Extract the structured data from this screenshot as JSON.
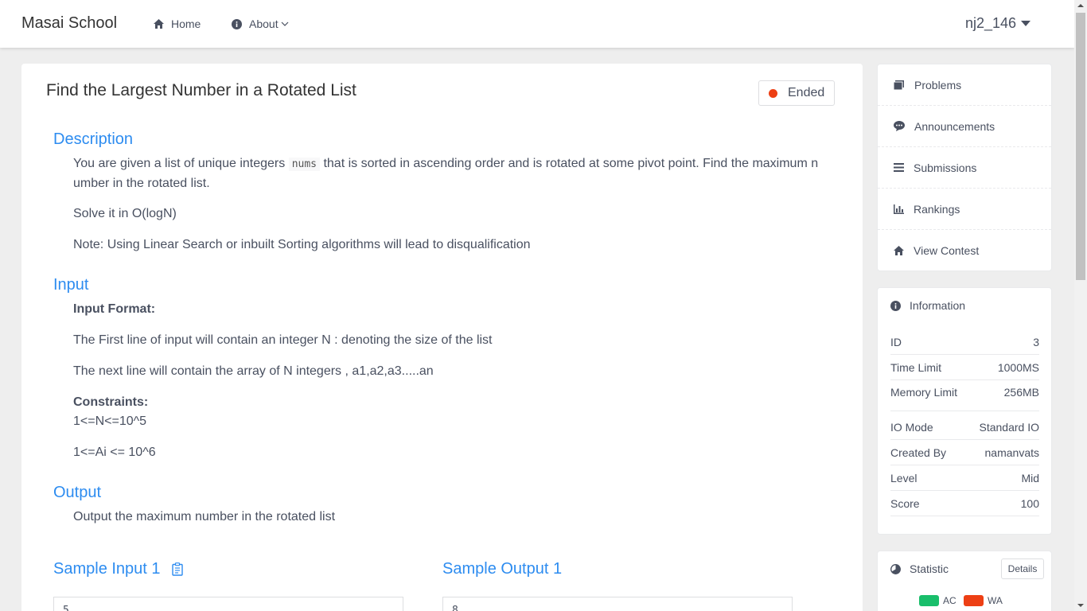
{
  "header": {
    "brand": "Masai School",
    "nav": {
      "home": "Home",
      "about": "About"
    },
    "user": "nj2_146"
  },
  "problem": {
    "title": "Find the Largest Number in a Rotated List",
    "status": "Ended",
    "status_color": "#ed3f14",
    "description_title": "Description",
    "description_p1_a": "You are given a list of unique integers ",
    "description_code": "nums",
    "description_p1_b": " that is sorted in ascending order and is rotated at some pivot point. Find the maximum n",
    "description_p1_c": "umber in the rotated list.",
    "description_p2": "Solve it in O(logN)",
    "description_p3": "Note: Using Linear Search or inbuilt Sorting algorithms will lead to disqualification",
    "input_title": "Input",
    "input_format_label": "Input Format:",
    "input_line1": "The First line of input will contain an integer N : denoting the size of the list",
    "input_line2": "The next line will contain the array of N integers , a1,a2,a3.....an",
    "constraints_label": "Constraints:",
    "constraint1": "1<=N<=10^5",
    "constraint2": "1<=Ai <= 10^6",
    "output_title": "Output",
    "output_text": "Output the maximum number in the rotated list",
    "sample_input_title": "Sample Input 1",
    "sample_input_value": "5",
    "sample_output_title": "Sample Output 1",
    "sample_output_value": "8"
  },
  "sidebar": {
    "menu": [
      "Problems",
      "Announcements",
      "Submissions",
      "Rankings",
      "View Contest"
    ],
    "info_title": "Information",
    "info": [
      {
        "label": "ID",
        "value": "3"
      },
      {
        "label": "Time Limit",
        "value": "1000MS"
      },
      {
        "label": "Memory Limit",
        "value": "256MB"
      },
      {
        "label": "IO Mode",
        "value": "Standard IO"
      },
      {
        "label": "Created By",
        "value": "namanvats"
      },
      {
        "label": "Level",
        "value": "Mid"
      },
      {
        "label": "Score",
        "value": "100"
      }
    ],
    "statistic_title": "Statistic",
    "details_label": "Details",
    "legend": [
      {
        "label": "AC",
        "color": "#19be6b"
      },
      {
        "label": "WA",
        "color": "#ed3f14"
      }
    ]
  }
}
